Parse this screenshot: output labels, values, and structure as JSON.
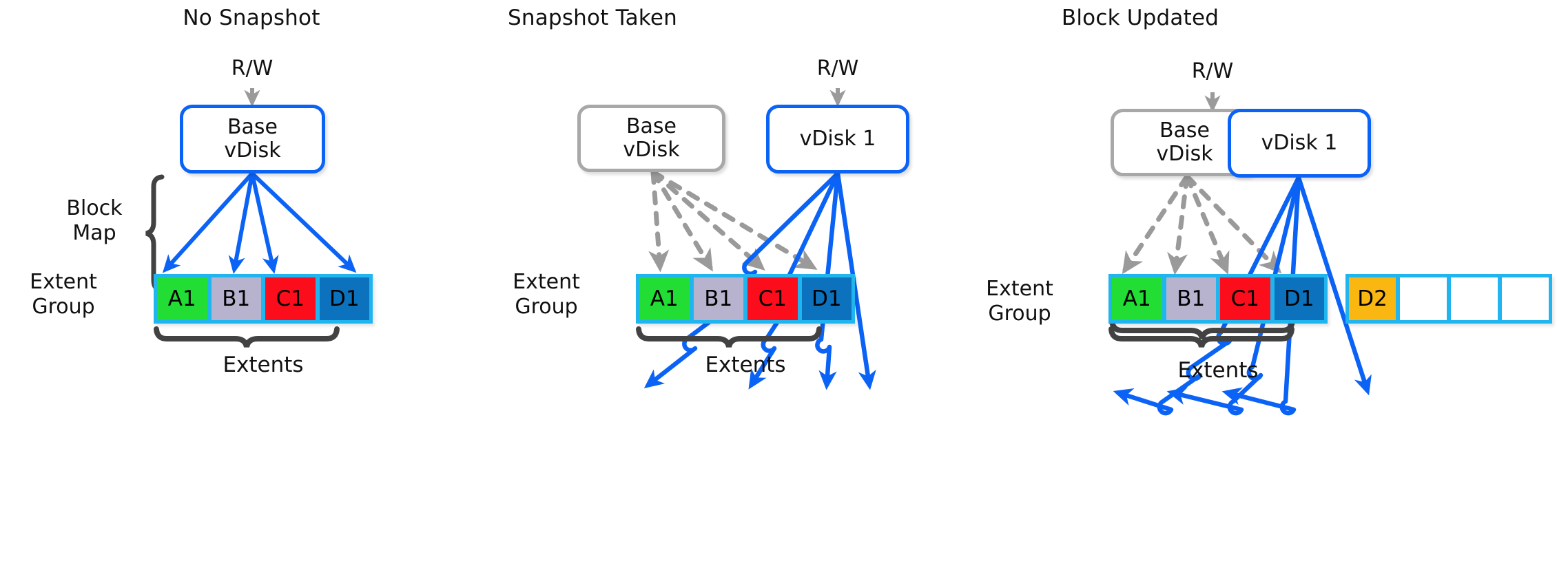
{
  "panels": [
    {
      "title": "No Snapshot",
      "rw_label": "R/W",
      "boxes": [
        {
          "label": "Base\nvDisk",
          "state": "active"
        }
      ],
      "side_labels": {
        "block_map": "Block\nMap",
        "extent_group": "Extent\nGroup"
      },
      "extent_groups": [
        {
          "cells": [
            {
              "label": "A1",
              "color": "#22dd33"
            },
            {
              "label": "B1",
              "color": "#b7b3cf"
            },
            {
              "label": "C1",
              "color": "#fc0d1b"
            },
            {
              "label": "D1",
              "color": "#0d72bd"
            }
          ]
        }
      ],
      "extents_label": "Extents"
    },
    {
      "title": "Snapshot Taken",
      "rw_label": "R/W",
      "boxes": [
        {
          "label": "Base\nvDisk",
          "state": "inactive"
        },
        {
          "label": "vDisk 1",
          "state": "active"
        }
      ],
      "side_labels": {
        "block_map": "",
        "extent_group": "Extent\nGroup"
      },
      "extent_groups": [
        {
          "cells": [
            {
              "label": "A1",
              "color": "#22dd33"
            },
            {
              "label": "B1",
              "color": "#b7b3cf"
            },
            {
              "label": "C1",
              "color": "#fc0d1b"
            },
            {
              "label": "D1",
              "color": "#0d72bd"
            }
          ]
        }
      ],
      "extents_label": "Extents"
    },
    {
      "title": "Block Updated",
      "rw_label": "R/W",
      "boxes": [
        {
          "label": "Base\nvDisk",
          "state": "inactive"
        },
        {
          "label": "vDisk 1",
          "state": "active"
        }
      ],
      "side_labels": {
        "block_map": "",
        "extent_group": "Extent\nGroup"
      },
      "extent_groups": [
        {
          "cells": [
            {
              "label": "A1",
              "color": "#22dd33"
            },
            {
              "label": "B1",
              "color": "#b7b3cf"
            },
            {
              "label": "C1",
              "color": "#fc0d1b"
            },
            {
              "label": "D1",
              "color": "#0d72bd"
            }
          ]
        },
        {
          "cells": [
            {
              "label": "D2",
              "color": "#fbb711"
            },
            {
              "label": "",
              "color": "#ffffff"
            },
            {
              "label": "",
              "color": "#ffffff"
            },
            {
              "label": "",
              "color": "#ffffff"
            }
          ]
        }
      ],
      "extents_label": "Extents"
    }
  ],
  "colors": {
    "accent_blue": "#0b63f6",
    "extent_border_cyan": "#21b5ef",
    "inactive_gray": "#a8a8a8",
    "arrow_gray": "#9a9a9a",
    "brace_dark": "#424242",
    "cell_green": "#22dd33",
    "cell_purple": "#b7b3cf",
    "cell_red": "#fc0d1b",
    "cell_blue": "#0d72bd",
    "cell_orange": "#fbb711",
    "cell_empty": "#ffffff",
    "text": "#111111",
    "background": "#ffffff"
  }
}
